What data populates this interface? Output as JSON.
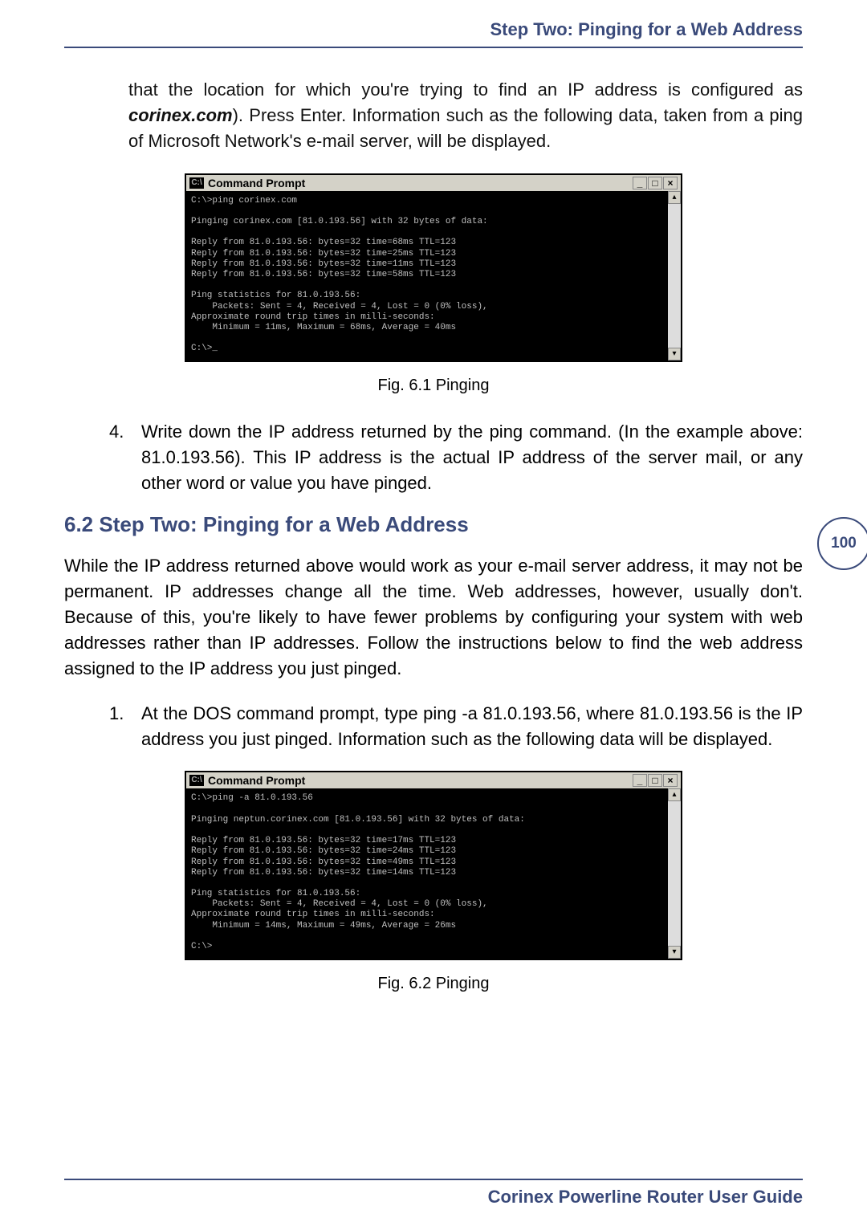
{
  "header": {
    "title": "Step Two: Pinging for a Web Address"
  },
  "intro_continuation": {
    "pre": "that the location for which you're trying to find an IP address is configured as ",
    "bold_italic": "corinex.com",
    "post": "). Press Enter. Information such as the following data, taken from a ping of Microsoft Network's e-mail server, will be displayed."
  },
  "cmd1": {
    "title": "Command Prompt",
    "minimize": "_",
    "maximize": "□",
    "close": "×",
    "scroll_up": "▴",
    "scroll_down": "▾",
    "body": "C:\\>ping corinex.com\n\nPinging corinex.com [81.0.193.56] with 32 bytes of data:\n\nReply from 81.0.193.56: bytes=32 time=68ms TTL=123\nReply from 81.0.193.56: bytes=32 time=25ms TTL=123\nReply from 81.0.193.56: bytes=32 time=11ms TTL=123\nReply from 81.0.193.56: bytes=32 time=58ms TTL=123\n\nPing statistics for 81.0.193.56:\n    Packets: Sent = 4, Received = 4, Lost = 0 (0% loss),\nApproximate round trip times in milli-seconds:\n    Minimum = 11ms, Maximum = 68ms, Average = 40ms\n\nC:\\>_"
  },
  "fig1_caption": "Fig. 6.1 Pinging",
  "step4": {
    "num": "4.",
    "text": "Write down the IP address returned by the ping command. (In the example above: 81.0.193.56). This IP address is the actual IP address of the server mail, or any other word or value you have pinged."
  },
  "section": {
    "heading": "6.2 Step Two: Pinging for a Web Address"
  },
  "para1": "While the IP address returned above would work as your e-mail server address, it may not be permanent. IP addresses change all the time. Web addresses, however, usually don't. Because of this, you're likely to have fewer problems by configuring your system with web addresses rather than IP addresses. Follow the instructions below to find the web address assigned to the IP address you just pinged.",
  "step1b": {
    "num": "1.",
    "text": "At the DOS command prompt, type ping -a 81.0.193.56, where 81.0.193.56 is the IP address you just pinged. Information such as the following data will be displayed."
  },
  "cmd2": {
    "title": "Command Prompt",
    "minimize": "_",
    "maximize": "□",
    "close": "×",
    "scroll_up": "▴",
    "scroll_down": "▾",
    "body": "C:\\>ping -a 81.0.193.56\n\nPinging neptun.corinex.com [81.0.193.56] with 32 bytes of data:\n\nReply from 81.0.193.56: bytes=32 time=17ms TTL=123\nReply from 81.0.193.56: bytes=32 time=24ms TTL=123\nReply from 81.0.193.56: bytes=32 time=49ms TTL=123\nReply from 81.0.193.56: bytes=32 time=14ms TTL=123\n\nPing statistics for 81.0.193.56:\n    Packets: Sent = 4, Received = 4, Lost = 0 (0% loss),\nApproximate round trip times in milli-seconds:\n    Minimum = 14ms, Maximum = 49ms, Average = 26ms\n\nC:\\>"
  },
  "fig2_caption": "Fig. 6.2 Pinging",
  "page_number": "100",
  "footer": {
    "text": "Corinex Powerline Router User Guide"
  }
}
